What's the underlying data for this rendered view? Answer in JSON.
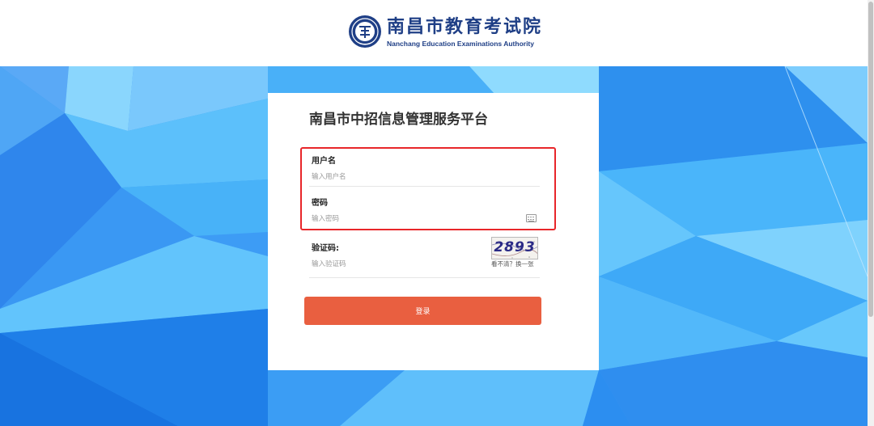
{
  "header": {
    "logo_cn": "南昌市教育考试院",
    "logo_en": "Nanchang Education Examinations Authority",
    "emblem_icon": "institution-emblem-icon",
    "brand_color": "#1f3f86"
  },
  "login": {
    "title": "南昌市中招信息管理服务平台",
    "username": {
      "label": "用户名",
      "placeholder": "输入用户名"
    },
    "password": {
      "label": "密码",
      "placeholder": "输入密码",
      "icon": "keyboard-icon"
    },
    "captcha": {
      "label": "验证码:",
      "placeholder": "输入验证码",
      "image_text": "2893",
      "refresh_text": "看不清？换一张"
    },
    "submit_label": "登录",
    "highlight_color": "#e8262a",
    "button_color": "#e95f40"
  },
  "background": {
    "palette": [
      "#3d9cf5",
      "#5bb8fb",
      "#7fd2fd",
      "#1f7fe8"
    ]
  }
}
